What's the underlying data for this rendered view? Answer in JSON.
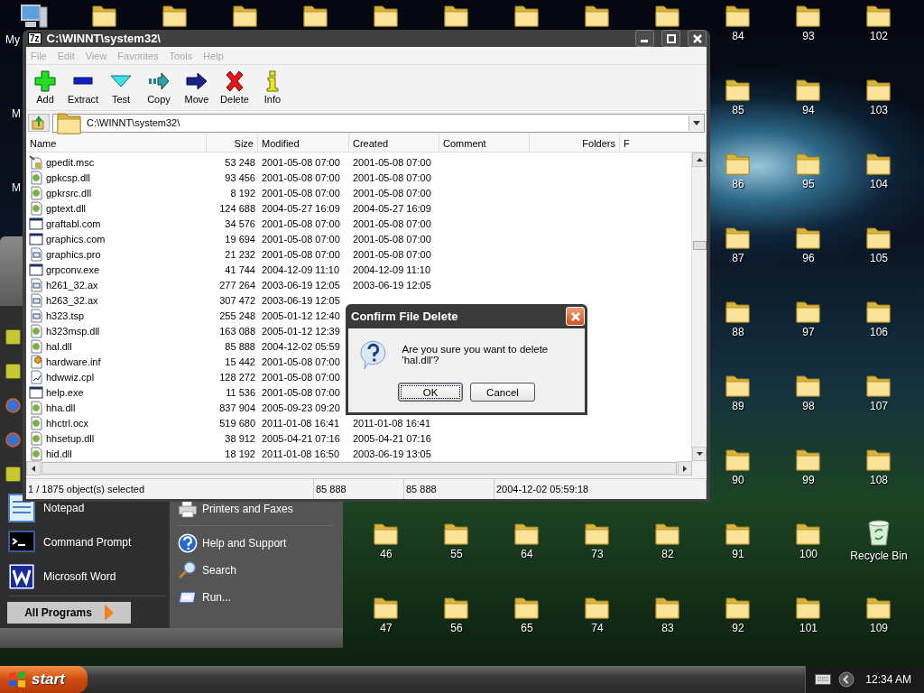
{
  "desktop": {
    "top_row": [
      {
        "kind": "computer",
        "label": "My"
      },
      {
        "kind": "folder"
      },
      {
        "kind": "folder"
      },
      {
        "kind": "folder"
      },
      {
        "kind": "folder"
      },
      {
        "kind": "folder"
      },
      {
        "kind": "folder"
      },
      {
        "kind": "folder"
      },
      {
        "kind": "folder"
      },
      {
        "kind": "folder"
      },
      {
        "kind": "folder",
        "label": "84"
      },
      {
        "kind": "folder",
        "label": "93"
      },
      {
        "kind": "folder",
        "label": "102"
      }
    ],
    "left_labels": [
      "M",
      "M"
    ],
    "right_columns": [
      {
        "icons": [
          {
            "kind": "folder",
            "label": "85"
          },
          {
            "kind": "folder",
            "label": "86"
          },
          {
            "kind": "folder",
            "label": "87"
          },
          {
            "kind": "folder",
            "label": "88"
          },
          {
            "kind": "folder",
            "label": "89"
          },
          {
            "kind": "folder",
            "label": "90"
          }
        ]
      },
      {
        "icons": [
          {
            "kind": "folder",
            "label": "94"
          },
          {
            "kind": "folder",
            "label": "95"
          },
          {
            "kind": "folder",
            "label": "96"
          },
          {
            "kind": "folder",
            "label": "97"
          },
          {
            "kind": "folder",
            "label": "98"
          },
          {
            "kind": "folder",
            "label": "99"
          }
        ]
      },
      {
        "icons": [
          {
            "kind": "folder",
            "label": "103"
          },
          {
            "kind": "folder",
            "label": "104"
          },
          {
            "kind": "folder",
            "label": "105"
          },
          {
            "kind": "folder",
            "label": "106"
          },
          {
            "kind": "folder",
            "label": "107"
          },
          {
            "kind": "folder",
            "label": "108"
          }
        ]
      }
    ],
    "bottom_rows": [
      {
        "icons": [
          {
            "kind": "folder",
            "label": "46"
          },
          {
            "kind": "folder",
            "label": "55"
          },
          {
            "kind": "folder",
            "label": "64"
          },
          {
            "kind": "folder",
            "label": "73"
          },
          {
            "kind": "folder",
            "label": "82"
          },
          {
            "kind": "folder",
            "label": "91"
          },
          {
            "kind": "folder",
            "label": "100"
          },
          {
            "kind": "recycle",
            "label": "Recycle Bin"
          }
        ]
      },
      {
        "icons": [
          {
            "kind": "folder",
            "label": "47"
          },
          {
            "kind": "folder",
            "label": "56"
          },
          {
            "kind": "folder",
            "label": "65"
          },
          {
            "kind": "folder",
            "label": "74"
          },
          {
            "kind": "folder",
            "label": "83"
          },
          {
            "kind": "folder",
            "label": "92"
          },
          {
            "kind": "folder",
            "label": "101"
          },
          {
            "kind": "folder",
            "label": "109"
          }
        ]
      }
    ]
  },
  "start_menu": {
    "left_items": [
      {
        "kind": "app"
      },
      {
        "kind": "app"
      },
      {
        "kind": "browser"
      },
      {
        "kind": "browser"
      },
      {
        "kind": "app"
      },
      {
        "kind": "notepad",
        "label": "Notepad"
      },
      {
        "kind": "console",
        "label": "Command Prompt"
      },
      {
        "kind": "word",
        "label": "Microsoft Word"
      }
    ],
    "all_programs": "All Programs",
    "right_items": [
      {
        "kind": "printer",
        "label": "Printers and Faxes"
      },
      {
        "kind": "help",
        "label": "Help and Support"
      },
      {
        "kind": "search",
        "label": "Search"
      },
      {
        "kind": "run",
        "label": "Run..."
      }
    ]
  },
  "window": {
    "logo": "7z",
    "title": "C:\\WINNT\\system32\\",
    "menu": [
      {
        "label": "File",
        "disabled": true
      },
      {
        "label": "Edit",
        "disabled": true
      },
      {
        "label": "View",
        "disabled": true
      },
      {
        "label": "Favorites",
        "disabled": true
      },
      {
        "label": "Tools",
        "disabled": true
      },
      {
        "label": "Help",
        "disabled": true
      }
    ],
    "toolbar": [
      {
        "kind": "add",
        "label": "Add"
      },
      {
        "kind": "extract",
        "label": "Extract"
      },
      {
        "kind": "test",
        "label": "Test"
      },
      {
        "kind": "copy",
        "label": "Copy"
      },
      {
        "kind": "move",
        "label": "Move"
      },
      {
        "kind": "delete",
        "label": "Delete"
      },
      {
        "kind": "info",
        "label": "Info"
      }
    ],
    "address": "C:\\WINNT\\system32\\",
    "columns": [
      "Name",
      "Size",
      "Modified",
      "Created",
      "Comment",
      "Folders",
      "F"
    ],
    "rows": [
      {
        "kind": "msc",
        "name": "gpedit.msc",
        "size": "53 248",
        "modified": "2001-05-08 07:00",
        "created": "2001-05-08 07:00"
      },
      {
        "kind": "dll",
        "name": "gpkcsp.dll",
        "size": "93 456",
        "modified": "2001-05-08 07:00",
        "created": "2001-05-08 07:00"
      },
      {
        "kind": "dll",
        "name": "gpkrsrc.dll",
        "size": "8 192",
        "modified": "2001-05-08 07:00",
        "created": "2001-05-08 07:00"
      },
      {
        "kind": "dll",
        "name": "gptext.dll",
        "size": "124 688",
        "modified": "2004-05-27 16:09",
        "created": "2004-05-27 16:09"
      },
      {
        "kind": "app",
        "name": "graftabl.com",
        "size": "34 576",
        "modified": "2001-05-08 07:00",
        "created": "2001-05-08 07:00"
      },
      {
        "kind": "app",
        "name": "graphics.com",
        "size": "19 694",
        "modified": "2001-05-08 07:00",
        "created": "2001-05-08 07:00"
      },
      {
        "kind": "config",
        "name": "graphics.pro",
        "size": "21 232",
        "modified": "2001-05-08 07:00",
        "created": "2001-05-08 07:00"
      },
      {
        "kind": "app",
        "name": "grpconv.exe",
        "size": "41 744",
        "modified": "2004-12-09 11:10",
        "created": "2004-12-09 11:10"
      },
      {
        "kind": "config",
        "name": "h261_32.ax",
        "size": "277 264",
        "modified": "2003-06-19 12:05",
        "created": "2003-06-19 12:05"
      },
      {
        "kind": "config",
        "name": "h263_32.ax",
        "size": "307 472",
        "modified": "2003-06-19 12:05"
      },
      {
        "kind": "config",
        "name": "h323.tsp",
        "size": "255 248",
        "modified": "2005-01-12 12:40"
      },
      {
        "kind": "dll",
        "name": "h323msp.dll",
        "size": "163 088",
        "modified": "2005-01-12 12:39"
      },
      {
        "kind": "dll",
        "name": "hal.dll",
        "size": "85 888",
        "modified": "2004-12-02 05:59"
      },
      {
        "kind": "inf",
        "name": "hardware.inf",
        "size": "15 442",
        "modified": "2001-05-08 07:00"
      },
      {
        "kind": "cpl",
        "name": "hdwwiz.cpl",
        "size": "128 272",
        "modified": "2001-05-08 07:00"
      },
      {
        "kind": "app",
        "name": "help.exe",
        "size": "11 536",
        "modified": "2001-05-08 07:00"
      },
      {
        "kind": "dll",
        "name": "hha.dll",
        "size": "837 904",
        "modified": "2005-09-23 09:20"
      },
      {
        "kind": "dll",
        "name": "hhctrl.ocx",
        "size": "519 680",
        "modified": "2011-01-08 16:41",
        "created": "2011-01-08 16:41"
      },
      {
        "kind": "dll",
        "name": "hhsetup.dll",
        "size": "38 912",
        "modified": "2005-04-21 07:16",
        "created": "2005-04-21 07:16"
      },
      {
        "kind": "dll",
        "name": "hid.dll",
        "size": "18 192",
        "modified": "2011-01-08 16:50",
        "created": "2003-06-19 13:05"
      }
    ],
    "status": [
      "1 / 1875 object(s) selected",
      "85 888",
      "85 888",
      "2004-12-02 05:59:18"
    ]
  },
  "dialog": {
    "title": "Confirm File Delete",
    "message": "Are you sure you want to delete 'hal.dll'?",
    "buttons": [
      {
        "label": "OK",
        "default": true
      },
      {
        "label": "Cancel",
        "default": false
      }
    ]
  },
  "taskbar": {
    "start": "start",
    "clock": "12:34 AM"
  }
}
